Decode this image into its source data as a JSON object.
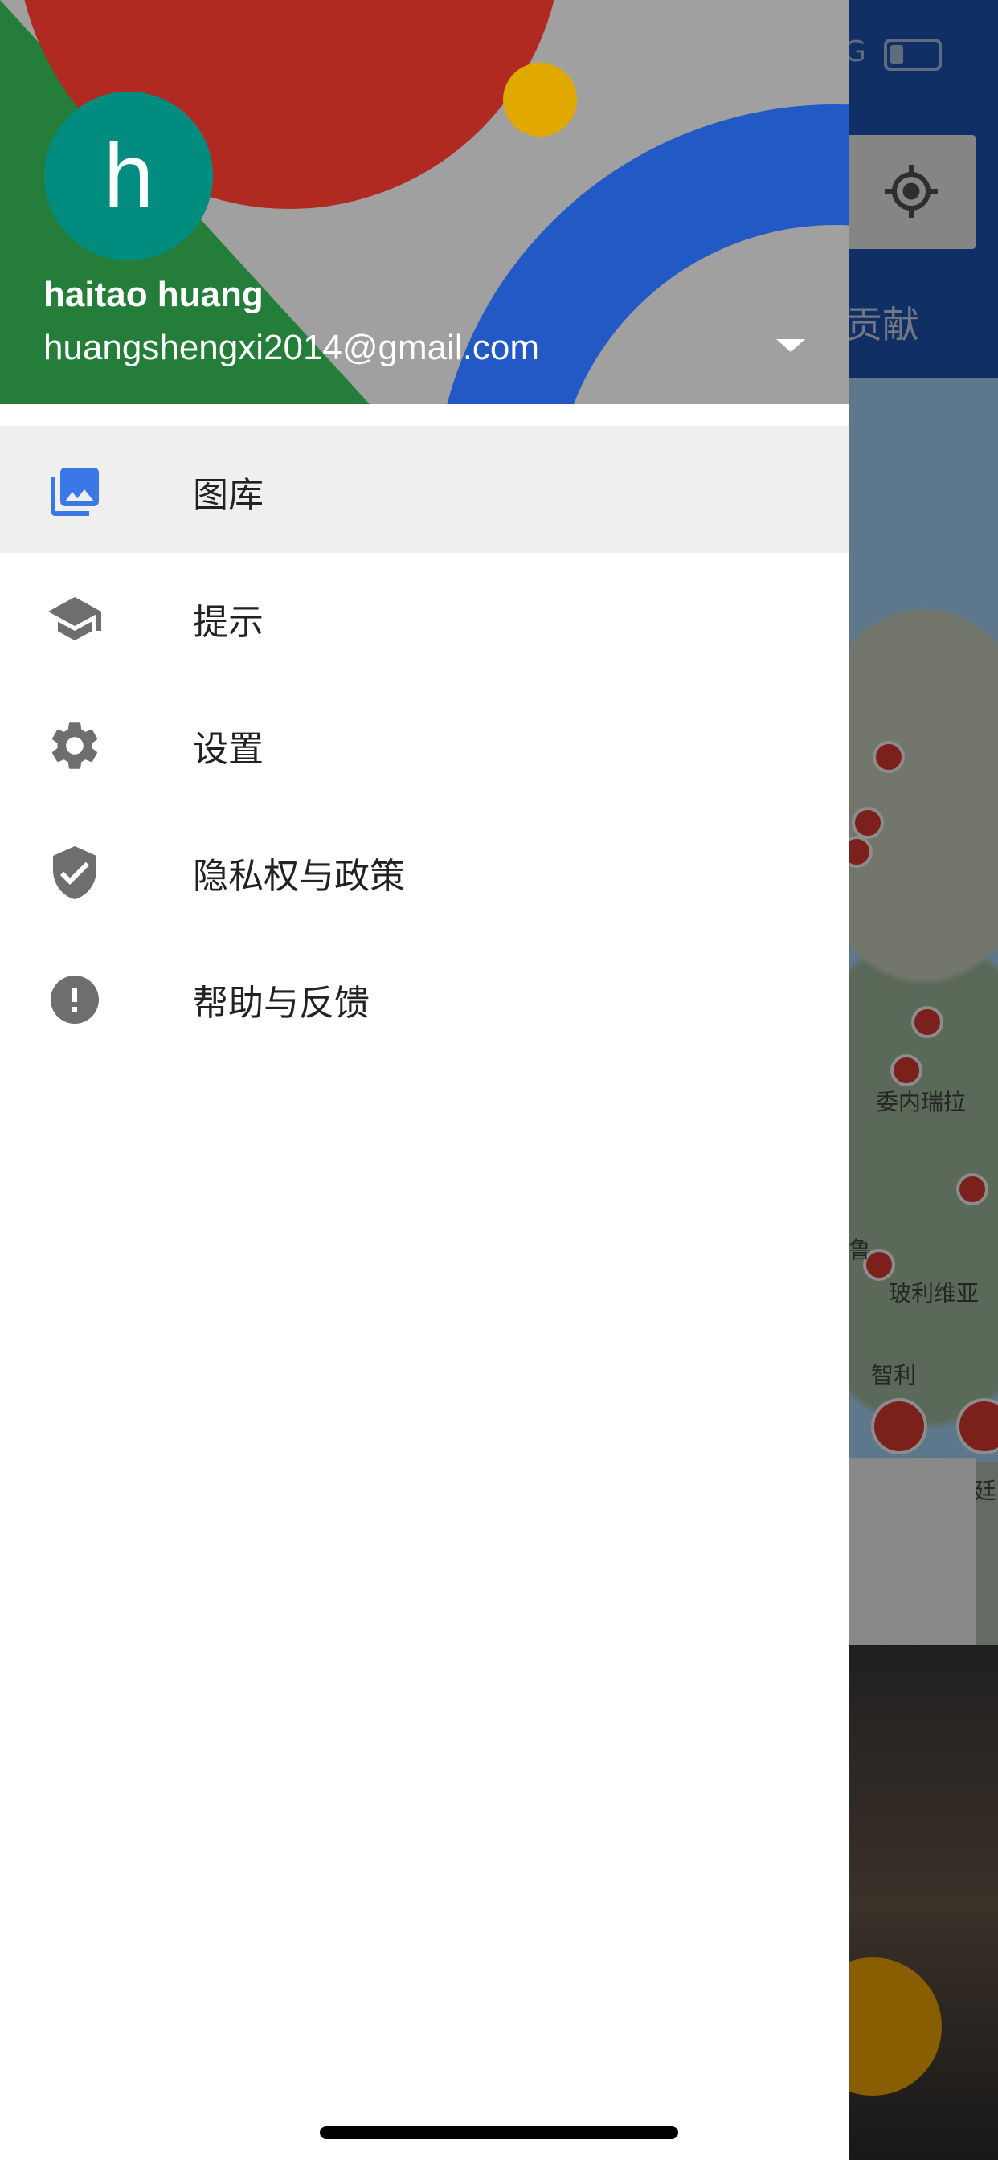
{
  "background": {
    "tab_label": "贡献",
    "status_text": "G",
    "map_labels": [
      "委内瑞拉",
      "鲁",
      "玻利维亚",
      "智利",
      "廷"
    ]
  },
  "drawer": {
    "avatar_letter": "h",
    "user_name": "haitao huang",
    "user_email": "huangshengxi2014@gmail.com",
    "menu": [
      {
        "label": "图库",
        "icon": "photo-library-icon",
        "selected": true
      },
      {
        "label": "提示",
        "icon": "school-icon",
        "selected": false
      },
      {
        "label": "设置",
        "icon": "gear-icon",
        "selected": false
      },
      {
        "label": "隐私权与政策",
        "icon": "shield-check-icon",
        "selected": false
      },
      {
        "label": "帮助与反馈",
        "icon": "alert-circle-icon",
        "selected": false
      }
    ]
  },
  "colors": {
    "accent_blue": "#3b78e7",
    "icon_gray": "#6e6e6e",
    "avatar_teal": "#008d80",
    "fab_yellow": "#f9ab00"
  }
}
